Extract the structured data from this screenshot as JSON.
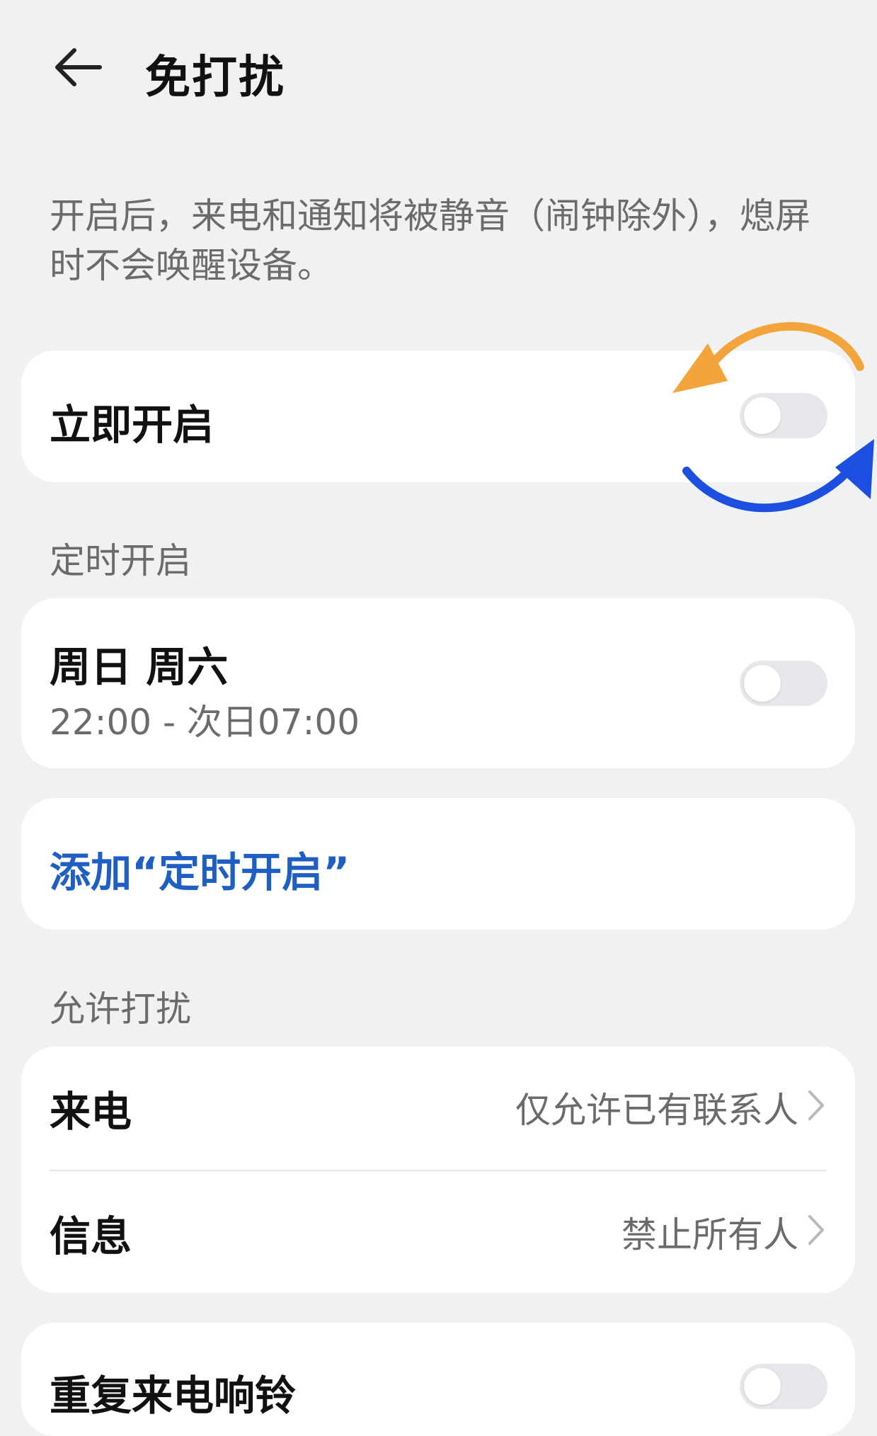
{
  "header": {
    "title": "免打扰"
  },
  "description": "开启后，来电和通知将被静音（闹钟除外），熄屏时不会唤醒设备。",
  "immediate": {
    "label": "立即开启",
    "enabled": false
  },
  "schedule_section": {
    "title": "定时开启",
    "item": {
      "days": "周日 周六",
      "time": "22:00 - 次日07:00",
      "enabled": false
    },
    "add_label": "添加“定时开启”"
  },
  "allow_section": {
    "title": "允许打扰",
    "items": [
      {
        "label": "来电",
        "value": "仅允许已有联系人"
      },
      {
        "label": "信息",
        "value": "禁止所有人"
      }
    ]
  },
  "repeat_call": {
    "label": "重复来电响铃"
  },
  "colors": {
    "accent_blue": "#1f5fc4",
    "arrow_orange": "#f3a43b",
    "arrow_blue": "#1c4fe0",
    "toggle_off": "#e6e7ea"
  },
  "icons": [
    "back-arrow-icon",
    "chevron-right-icon",
    "cycle-arrows-icon"
  ]
}
